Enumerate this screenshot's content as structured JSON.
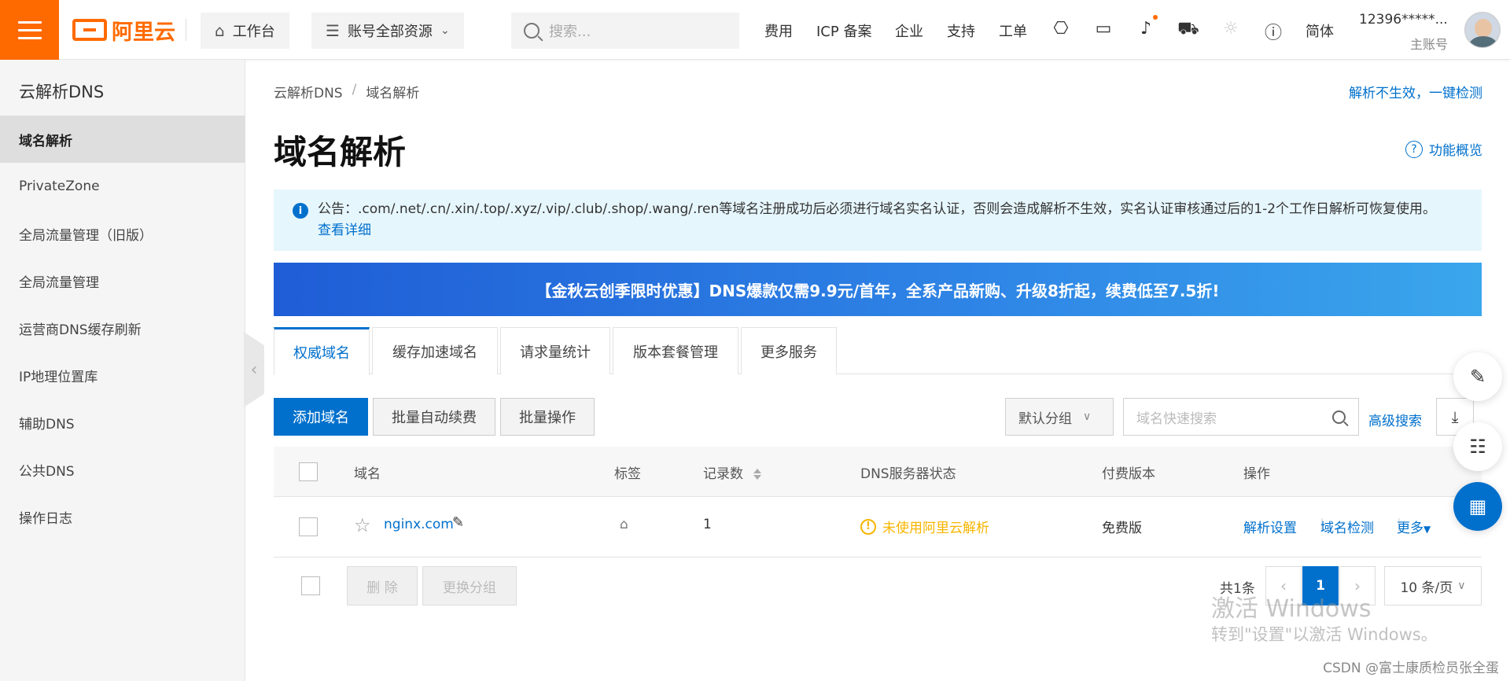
{
  "topbar": {
    "logo_text": "阿里云",
    "workbench": "工作台",
    "resources": "账号全部资源",
    "search_placeholder": "搜索...",
    "nav": [
      "费用",
      "ICP 备案",
      "企业",
      "支持",
      "工单"
    ],
    "lang": "简体",
    "user_name": "12396*****...",
    "user_role": "主账号"
  },
  "sidebar": {
    "title": "云解析DNS",
    "items": [
      "域名解析",
      "PrivateZone",
      "全局流量管理（旧版）",
      "全局流量管理",
      "运营商DNS缓存刷新",
      "IP地理位置库",
      "辅助DNS",
      "公共DNS",
      "操作日志"
    ]
  },
  "main": {
    "breadcrumb": [
      "云解析DNS",
      "域名解析"
    ],
    "check_link": "解析不生效，一键检测",
    "title": "域名解析",
    "overview": "功能概览",
    "notice": "公告：.com/.net/.cn/.xin/.top/.xyz/.vip/.club/.shop/.wang/.ren等域名注册成功后必须进行域名实名认证，否则会造成解析不生效，实名认证审核通过后的1-2个工作日解析可恢复使用。",
    "notice_more": "查看详细",
    "banner": "【金秋云创季限时优惠】DNS爆款仅需9.9元/首年，全系产品新购、升级8折起，续费低至7.5折!",
    "tabs": [
      "权威域名",
      "缓存加速域名",
      "请求量统计",
      "版本套餐管理",
      "更多服务"
    ],
    "toolbar": {
      "add": "添加域名",
      "auto_renew": "批量自动续费",
      "batch": "批量操作",
      "group": "默认分组",
      "search_placeholder": "域名快速搜索",
      "advanced": "高级搜索"
    },
    "table": {
      "headers": [
        "域名",
        "标签",
        "记录数",
        "DNS服务器状态",
        "付费版本",
        "操作"
      ],
      "rows": [
        {
          "domain": "nginx.com",
          "records": "1",
          "dns_status": "未使用阿里云解析",
          "plan": "免费版",
          "actions": [
            "解析设置",
            "域名检测",
            "更多"
          ]
        }
      ]
    },
    "footer": {
      "delete": "删 除",
      "change_group": "更换分组",
      "total": "共1条",
      "page": "1",
      "per_page": "10 条/页"
    }
  },
  "overlay": {
    "watermark_title": "激活 Windows",
    "watermark_sub": "转到\"设置\"以激活 Windows。",
    "csdn": "CSDN @富士康质检员张全蛋"
  },
  "colors": {
    "brand": "#ff6a00",
    "primary": "#0070cc",
    "warning": "#f7b500"
  }
}
